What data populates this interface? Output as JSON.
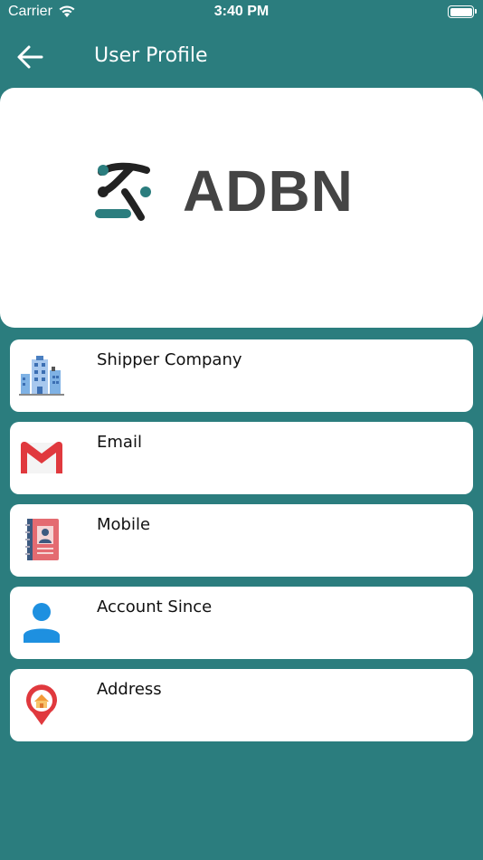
{
  "status_bar": {
    "carrier": "Carrier",
    "time": "3:40 PM",
    "battery_level": 1.0
  },
  "nav": {
    "title": "User Profile",
    "back_icon": "arrow-left-icon"
  },
  "logo": {
    "text": "ADBN",
    "accent_color": "#2b7d7e",
    "dark_color": "#222222"
  },
  "colors": {
    "background": "#2b7d7e",
    "card": "#ffffff"
  },
  "fields": [
    {
      "label": "Shipper Company",
      "value": "",
      "icon": "office-building-icon"
    },
    {
      "label": "Email",
      "value": "",
      "icon": "gmail-envelope-icon"
    },
    {
      "label": "Mobile",
      "value": "",
      "icon": "contact-book-icon"
    },
    {
      "label": "Account Since",
      "value": "",
      "icon": "user-person-icon"
    },
    {
      "label": "Address",
      "value": "",
      "icon": "home-location-pin-icon"
    }
  ]
}
